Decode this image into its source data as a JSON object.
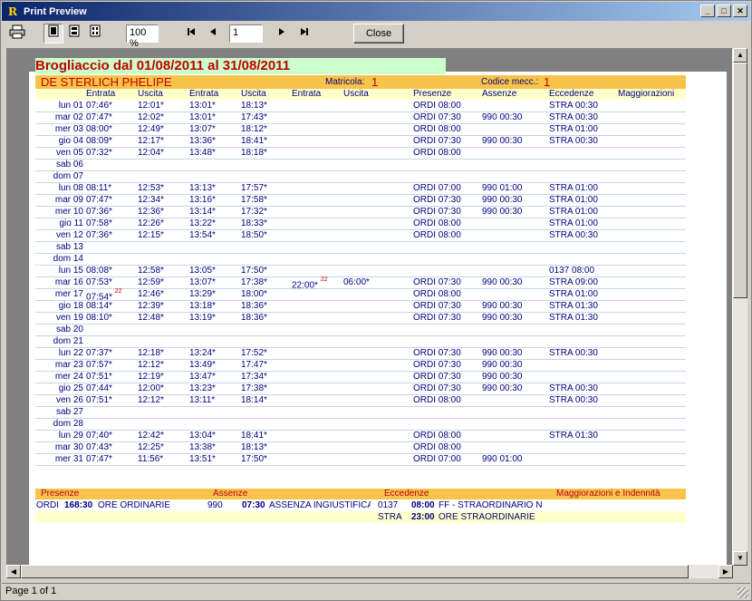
{
  "window": {
    "title": "Print Preview",
    "app_glyph": "R"
  },
  "toolbar": {
    "zoom": "100 %",
    "page": "1",
    "close": "Close"
  },
  "status": "Page 1 of 1",
  "report": {
    "title": "Brogliaccio dal 01/08/2011 al 31/08/2011",
    "employee": "DE STERLICH PHELIPE",
    "matricola_label": "Matricola:",
    "matricola": "1",
    "codice_label": "Codice mecc.:",
    "codice": "1",
    "columns": [
      "Entrata",
      "Uscita",
      "Entrata",
      "Uscita",
      "Entrata",
      "Uscita",
      "Presenze",
      "Assenze",
      "Eccedenze",
      "Maggiorazioni"
    ],
    "rows": [
      {
        "day": "lun 01",
        "e1": "07:46*",
        "u1": "12:01*",
        "e2": "13:01*",
        "u2": "18:13*",
        "e3": "",
        "u3": "",
        "pres": "ORDI 08:00",
        "ass": "",
        "ecc": "STRA 00:30"
      },
      {
        "day": "mar 02",
        "e1": "07:47*",
        "u1": "12:02*",
        "e2": "13:01*",
        "u2": "17:43*",
        "e3": "",
        "u3": "",
        "pres": "ORDI 07:30",
        "ass": "990 00:30",
        "ecc": "STRA 00:30"
      },
      {
        "day": "mer 03",
        "e1": "08:00*",
        "u1": "12:49*",
        "e2": "13:07*",
        "u2": "18:12*",
        "e3": "",
        "u3": "",
        "pres": "ORDI 08:00",
        "ass": "",
        "ecc": "STRA 01:00"
      },
      {
        "day": "gio 04",
        "e1": "08:09*",
        "u1": "12:17*",
        "e2": "13:36*",
        "u2": "18:41*",
        "e3": "",
        "u3": "",
        "pres": "ORDI 07:30",
        "ass": "990 00:30",
        "ecc": "STRA 00:30"
      },
      {
        "day": "ven 05",
        "e1": "07:32*",
        "u1": "12:04*",
        "e2": "13:48*",
        "u2": "18:18*",
        "e3": "",
        "u3": "",
        "pres": "ORDI 08:00",
        "ass": "",
        "ecc": ""
      },
      {
        "day": "sab 06",
        "e1": "",
        "u1": "",
        "e2": "",
        "u2": "",
        "e3": "",
        "u3": "",
        "pres": "",
        "ass": "",
        "ecc": ""
      },
      {
        "day": "dom 07",
        "e1": "",
        "u1": "",
        "e2": "",
        "u2": "",
        "e3": "",
        "u3": "",
        "pres": "",
        "ass": "",
        "ecc": ""
      },
      {
        "day": "lun 08",
        "e1": "08:11*",
        "u1": "12:53*",
        "e2": "13:13*",
        "u2": "17:57*",
        "e3": "",
        "u3": "",
        "pres": "ORDI 07:00",
        "ass": "990 01:00",
        "ecc": "STRA 01:00"
      },
      {
        "day": "mar 09",
        "e1": "07:47*",
        "u1": "12:34*",
        "e2": "13:16*",
        "u2": "17:58*",
        "e3": "",
        "u3": "",
        "pres": "ORDI 07:30",
        "ass": "990 00:30",
        "ecc": "STRA 01:00"
      },
      {
        "day": "mer 10",
        "e1": "07:36*",
        "u1": "12:36*",
        "e2": "13:14*",
        "u2": "17:32*",
        "e3": "",
        "u3": "",
        "pres": "ORDI 07:30",
        "ass": "990 00:30",
        "ecc": "STRA 01:00"
      },
      {
        "day": "gio 11",
        "e1": "07:58*",
        "u1": "12:26*",
        "e2": "13:22*",
        "u2": "18:33*",
        "e3": "",
        "u3": "",
        "pres": "ORDI 08:00",
        "ass": "",
        "ecc": "STRA 01:00"
      },
      {
        "day": "ven 12",
        "e1": "07:36*",
        "u1": "12:15*",
        "e2": "13:54*",
        "u2": "18:50*",
        "e3": "",
        "u3": "",
        "pres": "ORDI 08:00",
        "ass": "",
        "ecc": "STRA 00:30"
      },
      {
        "day": "sab 13",
        "e1": "",
        "u1": "",
        "e2": "",
        "u2": "",
        "e3": "",
        "u3": "",
        "pres": "",
        "ass": "",
        "ecc": ""
      },
      {
        "day": "dom 14",
        "e1": "",
        "u1": "",
        "e2": "",
        "u2": "",
        "e3": "",
        "u3": "",
        "pres": "",
        "ass": "",
        "ecc": ""
      },
      {
        "day": "lun 15",
        "e1": "08:08*",
        "u1": "12:58*",
        "e2": "13:05*",
        "u2": "17:50*",
        "e3": "",
        "u3": "",
        "pres": "",
        "ass": "",
        "ecc": "0137 08:00"
      },
      {
        "day": "mar 16",
        "e1": "07:53*",
        "u1": "12:59*",
        "e2": "13:07*",
        "u2": "17:38*",
        "e3": "22:00*",
        "e3sup": "22",
        "u3": "06:00*",
        "pres": "ORDI 07:30",
        "ass": "990 00:30",
        "ecc": "STRA 09:00"
      },
      {
        "day": "mer 17",
        "e1": "07:54*",
        "e1sup": "22",
        "u1": "12:46*",
        "e2": "13:29*",
        "u2": "18:00*",
        "e3": "",
        "u3": "",
        "pres": "ORDI 08:00",
        "ass": "",
        "ecc": "STRA 01:00"
      },
      {
        "day": "gio 18",
        "e1": "08:14*",
        "u1": "12:39*",
        "e2": "13:18*",
        "u2": "18:36*",
        "e3": "",
        "u3": "",
        "pres": "ORDI 07:30",
        "ass": "990 00:30",
        "ecc": "STRA 01:30"
      },
      {
        "day": "ven 19",
        "e1": "08:10*",
        "u1": "12:48*",
        "e2": "13:19*",
        "u2": "18:36*",
        "e3": "",
        "u3": "",
        "pres": "ORDI 07:30",
        "ass": "990 00:30",
        "ecc": "STRA 01:30"
      },
      {
        "day": "sab 20",
        "e1": "",
        "u1": "",
        "e2": "",
        "u2": "",
        "e3": "",
        "u3": "",
        "pres": "",
        "ass": "",
        "ecc": ""
      },
      {
        "day": "dom 21",
        "e1": "",
        "u1": "",
        "e2": "",
        "u2": "",
        "e3": "",
        "u3": "",
        "pres": "",
        "ass": "",
        "ecc": ""
      },
      {
        "day": "lun 22",
        "e1": "07:37*",
        "u1": "12:18*",
        "e2": "13:24*",
        "u2": "17:52*",
        "e3": "",
        "u3": "",
        "pres": "ORDI 07:30",
        "ass": "990 00:30",
        "ecc": "STRA 00:30"
      },
      {
        "day": "mar 23",
        "e1": "07:57*",
        "u1": "12:12*",
        "e2": "13:49*",
        "u2": "17:47*",
        "e3": "",
        "u3": "",
        "pres": "ORDI 07:30",
        "ass": "990 00:30",
        "ecc": ""
      },
      {
        "day": "mer 24",
        "e1": "07:51*",
        "u1": "12:19*",
        "e2": "13:47*",
        "u2": "17:34*",
        "e3": "",
        "u3": "",
        "pres": "ORDI 07:30",
        "ass": "990 00:30",
        "ecc": ""
      },
      {
        "day": "gio 25",
        "e1": "07:44*",
        "u1": "12:00*",
        "e2": "13:23*",
        "u2": "17:38*",
        "e3": "",
        "u3": "",
        "pres": "ORDI 07:30",
        "ass": "990 00:30",
        "ecc": "STRA 00:30"
      },
      {
        "day": "ven 26",
        "e1": "07:51*",
        "u1": "12:12*",
        "e2": "13:11*",
        "u2": "18:14*",
        "e3": "",
        "u3": "",
        "pres": "ORDI 08:00",
        "ass": "",
        "ecc": "STRA 00:30"
      },
      {
        "day": "sab 27",
        "e1": "",
        "u1": "",
        "e2": "",
        "u2": "",
        "e3": "",
        "u3": "",
        "pres": "",
        "ass": "",
        "ecc": ""
      },
      {
        "day": "dom 28",
        "e1": "",
        "u1": "",
        "e2": "",
        "u2": "",
        "e3": "",
        "u3": "",
        "pres": "",
        "ass": "",
        "ecc": ""
      },
      {
        "day": "lun 29",
        "e1": "07:40*",
        "u1": "12:42*",
        "e2": "13:04*",
        "u2": "18:41*",
        "e3": "",
        "u3": "",
        "pres": "ORDI 08:00",
        "ass": "",
        "ecc": "STRA 01:30"
      },
      {
        "day": "mar 30",
        "e1": "07:43*",
        "u1": "12:25*",
        "e2": "13:38*",
        "u2": "18:13*",
        "e3": "",
        "u3": "",
        "pres": "ORDI 08:00",
        "ass": "",
        "ecc": ""
      },
      {
        "day": "mer 31",
        "e1": "07:47*",
        "u1": "11:56*",
        "e2": "13:51*",
        "u2": "17:50*",
        "e3": "",
        "u3": "",
        "pres": "ORDI 07:00",
        "ass": "990 01:00",
        "ecc": ""
      }
    ],
    "summary_headers": [
      "Presenze",
      "Assenze",
      "Eccedenze",
      "Maggiorazioni e Indennità"
    ],
    "summary": {
      "pres_code": "ORDI",
      "pres_hours": "168:30",
      "pres_desc": "ORE ORDINARIE",
      "ass_code": "990",
      "ass_hours": "07:30",
      "ass_desc": "ASSENZA INGIUSTIFICA",
      "ecc": [
        {
          "code": "0137",
          "hours": "08:00",
          "desc": "FF - STRAORDINARIO N"
        },
        {
          "code": "STRA",
          "hours": "23:00",
          "desc": "ORE STRAORDINARIE"
        }
      ]
    }
  },
  "colors": {
    "title_bg": "#ccffcc",
    "title_fg": "#c00000",
    "header_orange": "#f8c34a",
    "header_yellow": "#ffffcc",
    "text_navy": "#000080"
  },
  "icons": [
    "print-icon",
    "single-page-icon",
    "two-page-icon",
    "multi-page-icon",
    "first-page-icon",
    "prev-page-icon",
    "next-page-icon",
    "last-page-icon",
    "minimize-icon",
    "maximize-icon",
    "close-icon"
  ]
}
